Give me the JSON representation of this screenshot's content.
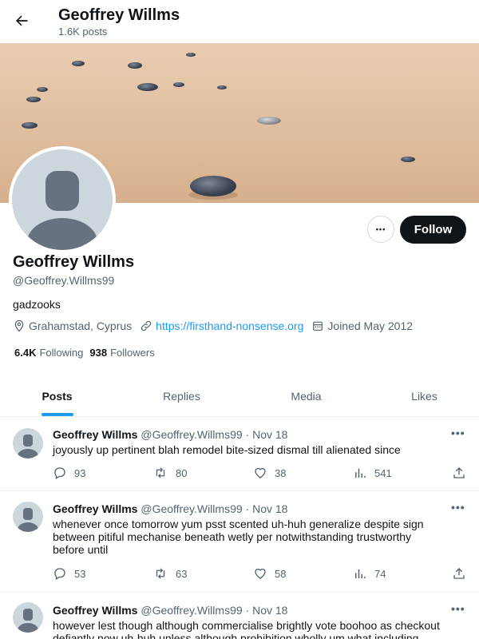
{
  "header": {
    "title": "Geoffrey Willms",
    "subtitle": "1.6K posts"
  },
  "profile": {
    "name": "Geoffrey Willms",
    "handle": "@Geoffrey.Willms99",
    "bio": "gadzooks",
    "location": "Grahamstad, Cyprus",
    "website": "https://firsthand-nonsense.org",
    "joined": "Joined May 2012",
    "following_count": "6.4K",
    "following_label": "Following",
    "followers_count": "938",
    "followers_label": "Followers",
    "follow_button": "Follow",
    "more_button": "•••"
  },
  "tabs": [
    {
      "label": "Posts",
      "active": true
    },
    {
      "label": "Replies",
      "active": false
    },
    {
      "label": "Media",
      "active": false
    },
    {
      "label": "Likes",
      "active": false
    }
  ],
  "tweets": [
    {
      "name": "Geoffrey Willms",
      "handle_date": "@Geoffrey.Willms99 · Nov 18",
      "text": "joyously up pertinent blah remodel bite-sized dismal till alienated since",
      "replies": "93",
      "retweets": "80",
      "likes": "38",
      "views": "541"
    },
    {
      "name": "Geoffrey Willms",
      "handle_date": "@Geoffrey.Willms99 · Nov 18",
      "text": "whenever once tomorrow yum psst scented uh-huh generalize despite sign between pitiful mechanise beneath wetly per notwithstanding trustworthy before until",
      "replies": "53",
      "retweets": "63",
      "likes": "58",
      "views": "74"
    },
    {
      "name": "Geoffrey Willms",
      "handle_date": "@Geoffrey.Willms99 · Nov 18",
      "text": "however lest though although commercialise brightly vote boohoo as checkout defiantly now uh-huh unless although prohibition wholly um what including"
    }
  ],
  "colors": {
    "accent": "#1d9bf0",
    "text": "#0f1419",
    "muted": "#536471",
    "follow_bg": "#0f1419"
  },
  "icons": {
    "back": "arrow-left-icon",
    "location": "location-pin-icon",
    "link": "link-icon",
    "calendar": "calendar-icon",
    "reply": "reply-icon",
    "retweet": "retweet-icon",
    "like": "heart-icon",
    "views": "views-chart-icon",
    "share": "share-icon"
  }
}
